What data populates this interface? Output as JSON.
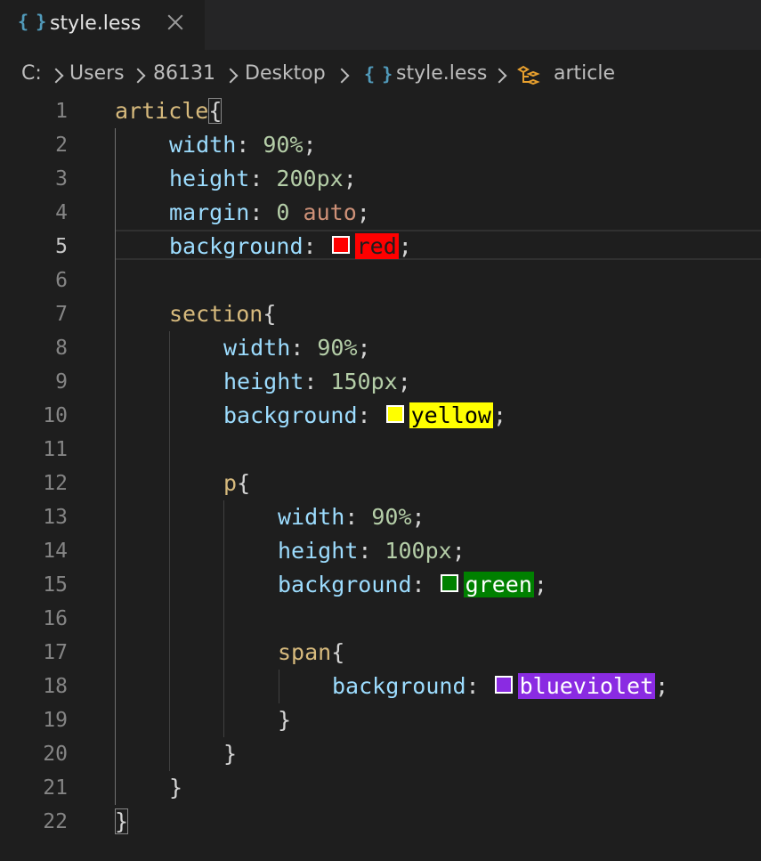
{
  "tab": {
    "icon": "braces-file-icon",
    "braces": "{ }",
    "title": "style.less"
  },
  "breadcrumb": {
    "drive": "C:",
    "users": "Users",
    "user": "86131",
    "desktop": "Desktop",
    "file": "style.less",
    "symbol": "article"
  },
  "colors": {
    "red": "#ff0000",
    "yellow": "#ffff00",
    "green": "#008000",
    "blueviolet": "#8a2be2"
  },
  "editor": {
    "active_line": 5,
    "lines": [
      {
        "n": "1",
        "indent": 0,
        "sel": "article",
        "open": "{"
      },
      {
        "n": "2",
        "indent": 1,
        "prop": "width",
        "value": "90%",
        "vtype": "num"
      },
      {
        "n": "3",
        "indent": 1,
        "prop": "height",
        "value": "200px",
        "vtype": "num"
      },
      {
        "n": "4",
        "indent": 1,
        "prop": "margin",
        "value": "0",
        "value2": "auto",
        "vtype": "margin"
      },
      {
        "n": "5",
        "indent": 1,
        "prop": "background",
        "value": "red",
        "vtype": "color"
      },
      {
        "n": "6",
        "indent": 0,
        "empty": true
      },
      {
        "n": "7",
        "indent": 1,
        "sel": "section",
        "open": "{"
      },
      {
        "n": "8",
        "indent": 2,
        "prop": "width",
        "value": "90%",
        "vtype": "num"
      },
      {
        "n": "9",
        "indent": 2,
        "prop": "height",
        "value": "150px",
        "vtype": "num"
      },
      {
        "n": "10",
        "indent": 2,
        "prop": "background",
        "value": "yellow",
        "vtype": "color"
      },
      {
        "n": "11",
        "indent": 0,
        "empty": true
      },
      {
        "n": "12",
        "indent": 2,
        "sel": "p",
        "open": "{"
      },
      {
        "n": "13",
        "indent": 3,
        "prop": "width",
        "value": "90%",
        "vtype": "num"
      },
      {
        "n": "14",
        "indent": 3,
        "prop": "height",
        "value": "100px",
        "vtype": "num"
      },
      {
        "n": "15",
        "indent": 3,
        "prop": "background",
        "value": "green",
        "vtype": "color"
      },
      {
        "n": "16",
        "indent": 0,
        "empty": true
      },
      {
        "n": "17",
        "indent": 3,
        "sel": "span",
        "open": "{"
      },
      {
        "n": "18",
        "indent": 4,
        "prop": "background",
        "value": "blueviolet",
        "vtype": "color"
      },
      {
        "n": "19",
        "indent": 3,
        "close": "}"
      },
      {
        "n": "20",
        "indent": 2,
        "close": "}"
      },
      {
        "n": "21",
        "indent": 1,
        "close": "}"
      },
      {
        "n": "22",
        "indent": 0,
        "close": "}",
        "boxed": true
      }
    ]
  }
}
